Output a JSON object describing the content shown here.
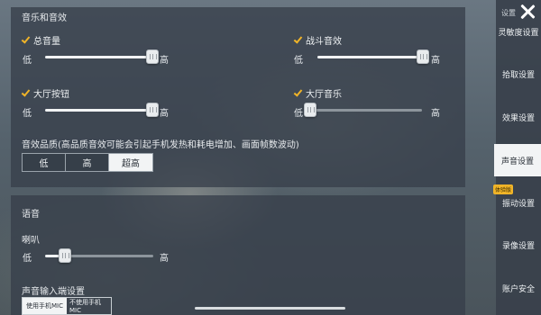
{
  "sound_section": {
    "title": "音乐和音效",
    "rows": [
      {
        "label": "总音量",
        "checked": true,
        "low": "低",
        "high": "高",
        "value": 0.92
      },
      {
        "label": "战斗音效",
        "checked": true,
        "low": "低",
        "high": "高",
        "value": 0.92
      },
      {
        "label": "大厅按钮",
        "checked": true,
        "low": "低",
        "high": "高",
        "value": 0.92
      },
      {
        "label": "大厅音乐",
        "checked": true,
        "low": "低",
        "high": "高",
        "value": 0.0
      }
    ],
    "quality_label": "音效品质(高品质音效可能会引起手机发热和耗电增加、画面帧数波动)",
    "quality_options": [
      "低",
      "高",
      "超高"
    ],
    "quality_selected": "超高"
  },
  "voice_section": {
    "title": "语音",
    "speaker_label": "喇叭",
    "speaker_low": "低",
    "speaker_high": "高",
    "speaker_value": 0.18,
    "input_label": "声音输入端设置",
    "input_options": [
      "使用手机MIC",
      "不使用手机MIC"
    ],
    "input_selected": "使用手机MIC"
  },
  "sidebar": {
    "header_label": "设置",
    "items": [
      {
        "label": "灵敏度设置",
        "active": false
      },
      {
        "label": "拾取设置",
        "active": false
      },
      {
        "label": "效果设置",
        "active": false
      },
      {
        "label": "声音设置",
        "active": true
      },
      {
        "label": "振动设置",
        "active": false
      },
      {
        "label": "录像设置",
        "active": false
      },
      {
        "label": "账户安全",
        "active": false
      }
    ],
    "badge": "体验版"
  },
  "colors": {
    "accent": "#f0b428",
    "panel": "#373f4a",
    "active": "#f2f4f5"
  }
}
